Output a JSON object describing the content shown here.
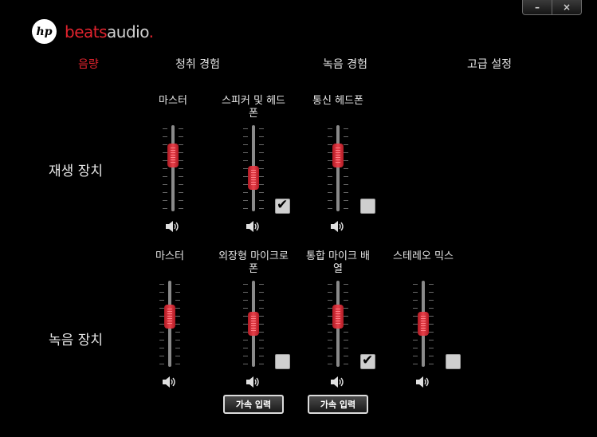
{
  "window": {
    "min_label": "–",
    "close_label": "×"
  },
  "brand": {
    "hp": "hp",
    "beats": "beats",
    "audio": "audio",
    "dot": "."
  },
  "tabs": [
    {
      "label": "음량",
      "active": true
    },
    {
      "label": "청취 경험",
      "active": false
    },
    {
      "label": "녹음 경험",
      "active": false
    },
    {
      "label": "고급 설정",
      "active": false
    }
  ],
  "playback": {
    "label": "재생 장치",
    "devices": [
      {
        "label": "마스터",
        "level": 0.7,
        "has_checkbox": false,
        "checked": false
      },
      {
        "label": "스피커 및 헤드폰",
        "level": 0.35,
        "has_checkbox": true,
        "checked": true
      },
      {
        "label": "통신 헤드폰",
        "level": 0.7,
        "has_checkbox": true,
        "checked": false
      }
    ]
  },
  "recording": {
    "label": "녹음 장치",
    "devices": [
      {
        "label": "마스터",
        "level": 0.62,
        "has_checkbox": false,
        "checked": false,
        "boost": ""
      },
      {
        "label": "외장형 마이크로폰",
        "level": 0.5,
        "has_checkbox": true,
        "checked": false,
        "boost": "가속 입력"
      },
      {
        "label": "통합 마이크 배열",
        "level": 0.62,
        "has_checkbox": true,
        "checked": true,
        "boost": "가속 입력"
      },
      {
        "label": "스테레오 믹스",
        "level": 0.5,
        "has_checkbox": true,
        "checked": false,
        "boost": ""
      }
    ]
  },
  "colors": {
    "accent": "#e2232e",
    "background": "#000000",
    "text": "#e6e6e6"
  },
  "icons": {
    "speaker": "speaker-icon",
    "checkmark": "checkmark-icon"
  }
}
